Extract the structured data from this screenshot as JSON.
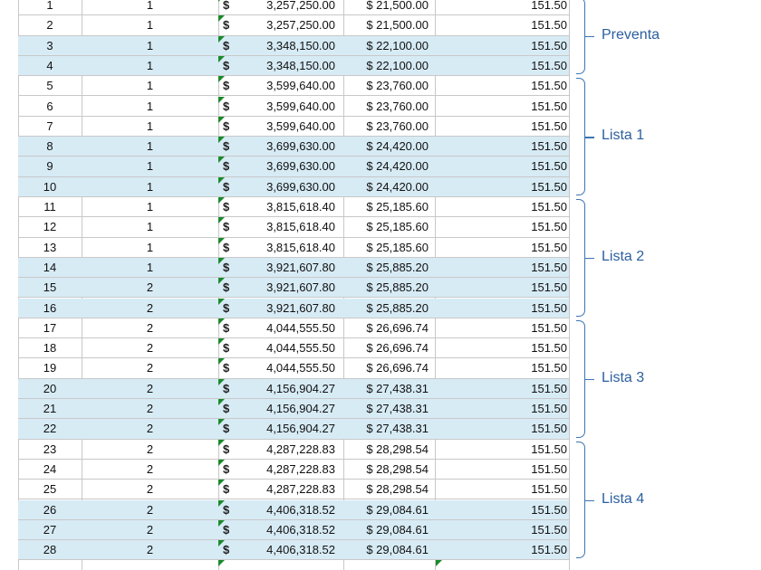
{
  "currency_symbol": "$",
  "accent_color": "#3c74b3",
  "highlight_color": "#d7ebf5",
  "rows": [
    {
      "n": "1",
      "q": "1",
      "price": "3,257,250.00",
      "unit": "$ 21,500.00",
      "rate": "151.50",
      "hl": false
    },
    {
      "n": "2",
      "q": "1",
      "price": "3,257,250.00",
      "unit": "$ 21,500.00",
      "rate": "151.50",
      "hl": false
    },
    {
      "n": "3",
      "q": "1",
      "price": "3,348,150.00",
      "unit": "$ 22,100.00",
      "rate": "151.50",
      "hl": true
    },
    {
      "n": "4",
      "q": "1",
      "price": "3,348,150.00",
      "unit": "$ 22,100.00",
      "rate": "151.50",
      "hl": true
    },
    {
      "n": "5",
      "q": "1",
      "price": "3,599,640.00",
      "unit": "$ 23,760.00",
      "rate": "151.50",
      "hl": false
    },
    {
      "n": "6",
      "q": "1",
      "price": "3,599,640.00",
      "unit": "$ 23,760.00",
      "rate": "151.50",
      "hl": false
    },
    {
      "n": "7",
      "q": "1",
      "price": "3,599,640.00",
      "unit": "$ 23,760.00",
      "rate": "151.50",
      "hl": false
    },
    {
      "n": "8",
      "q": "1",
      "price": "3,699,630.00",
      "unit": "$ 24,420.00",
      "rate": "151.50",
      "hl": true
    },
    {
      "n": "9",
      "q": "1",
      "price": "3,699,630.00",
      "unit": "$ 24,420.00",
      "rate": "151.50",
      "hl": true
    },
    {
      "n": "10",
      "q": "1",
      "price": "3,699,630.00",
      "unit": "$ 24,420.00",
      "rate": "151.50",
      "hl": true
    },
    {
      "n": "11",
      "q": "1",
      "price": "3,815,618.40",
      "unit": "$ 25,185.60",
      "rate": "151.50",
      "hl": false
    },
    {
      "n": "12",
      "q": "1",
      "price": "3,815,618.40",
      "unit": "$ 25,185.60",
      "rate": "151.50",
      "hl": false
    },
    {
      "n": "13",
      "q": "1",
      "price": "3,815,618.40",
      "unit": "$ 25,185.60",
      "rate": "151.50",
      "hl": false
    },
    {
      "n": "14",
      "q": "1",
      "price": "3,921,607.80",
      "unit": "$ 25,885.20",
      "rate": "151.50",
      "hl": true
    },
    {
      "n": "15",
      "q": "2",
      "price": "3,921,607.80",
      "unit": "$ 25,885.20",
      "rate": "151.50",
      "hl": true
    },
    {
      "n": "16",
      "q": "2",
      "price": "3,921,607.80",
      "unit": "$ 25,885.20",
      "rate": "151.50",
      "hl": true
    },
    {
      "n": "17",
      "q": "2",
      "price": "4,044,555.50",
      "unit": "$ 26,696.74",
      "rate": "151.50",
      "hl": false
    },
    {
      "n": "18",
      "q": "2",
      "price": "4,044,555.50",
      "unit": "$ 26,696.74",
      "rate": "151.50",
      "hl": false
    },
    {
      "n": "19",
      "q": "2",
      "price": "4,044,555.50",
      "unit": "$ 26,696.74",
      "rate": "151.50",
      "hl": false
    },
    {
      "n": "20",
      "q": "2",
      "price": "4,156,904.27",
      "unit": "$ 27,438.31",
      "rate": "151.50",
      "hl": true
    },
    {
      "n": "21",
      "q": "2",
      "price": "4,156,904.27",
      "unit": "$ 27,438.31",
      "rate": "151.50",
      "hl": true
    },
    {
      "n": "22",
      "q": "2",
      "price": "4,156,904.27",
      "unit": "$ 27,438.31",
      "rate": "151.50",
      "hl": true
    },
    {
      "n": "23",
      "q": "2",
      "price": "4,287,228.83",
      "unit": "$ 28,298.54",
      "rate": "151.50",
      "hl": false
    },
    {
      "n": "24",
      "q": "2",
      "price": "4,287,228.83",
      "unit": "$ 28,298.54",
      "rate": "151.50",
      "hl": false
    },
    {
      "n": "25",
      "q": "2",
      "price": "4,287,228.83",
      "unit": "$ 28,298.54",
      "rate": "151.50",
      "hl": false
    },
    {
      "n": "26",
      "q": "2",
      "price": "4,406,318.52",
      "unit": "$ 29,084.61",
      "rate": "151.50",
      "hl": true
    },
    {
      "n": "27",
      "q": "2",
      "price": "4,406,318.52",
      "unit": "$ 29,084.61",
      "rate": "151.50",
      "hl": true
    },
    {
      "n": "28",
      "q": "2",
      "price": "4,406,318.52",
      "unit": "$ 29,084.61",
      "rate": "151.50",
      "hl": true
    }
  ],
  "groups": [
    {
      "label": "Preventa",
      "first_row": 0,
      "last_row": 3
    },
    {
      "label": "Lista 1",
      "first_row": 4,
      "last_row": 9
    },
    {
      "label": "Lista 2",
      "first_row": 10,
      "last_row": 15
    },
    {
      "label": "Lista 3",
      "first_row": 16,
      "last_row": 21
    },
    {
      "label": "Lista 4",
      "first_row": 22,
      "last_row": 27
    }
  ]
}
